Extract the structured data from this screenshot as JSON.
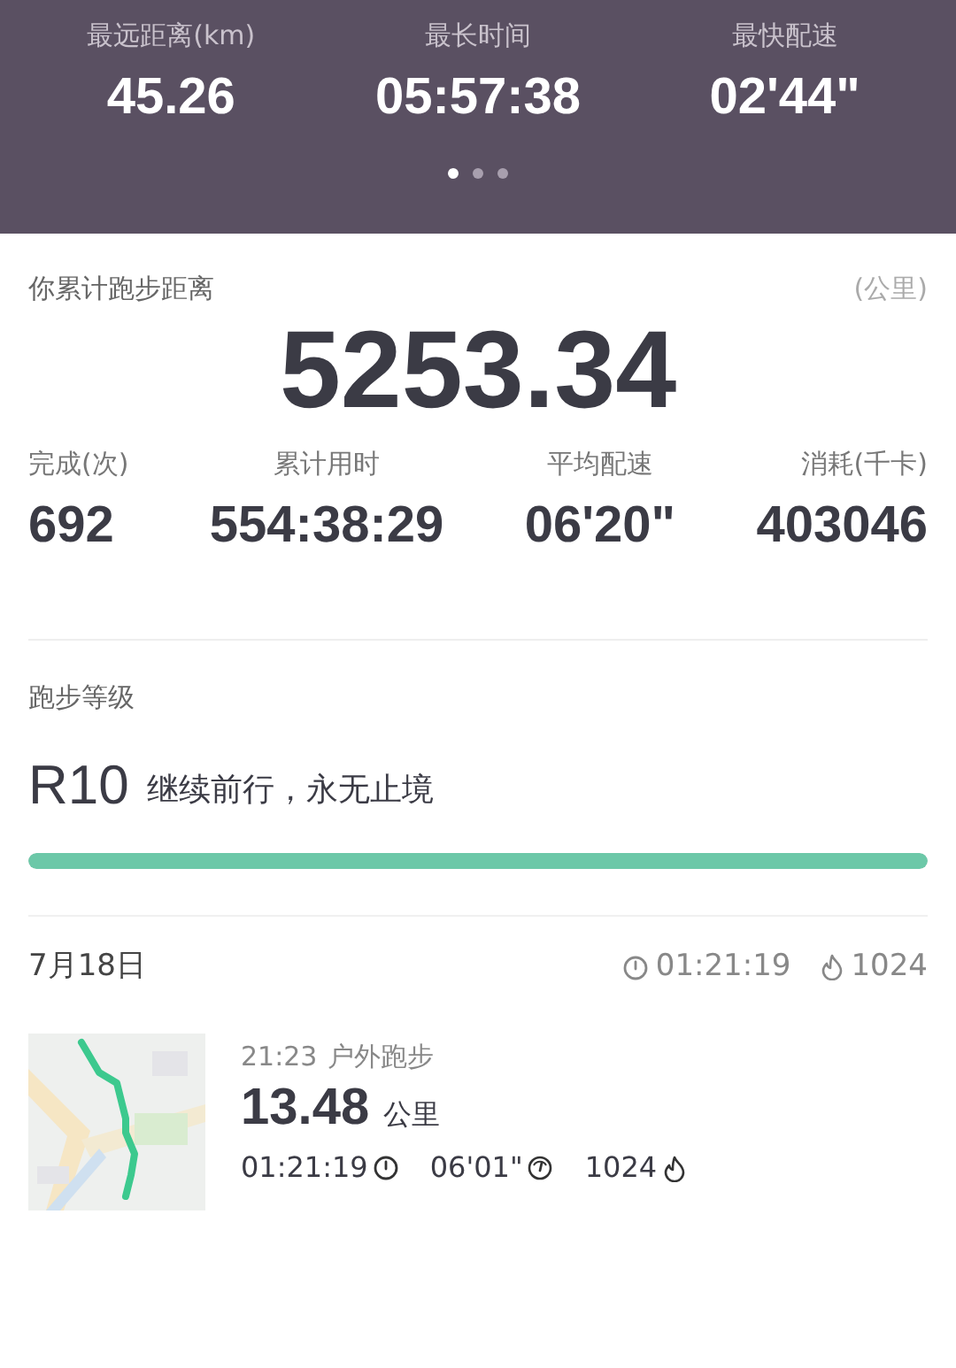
{
  "records": [
    {
      "label": "最远距离(km)",
      "value": "45.26"
    },
    {
      "label": "最长时间",
      "value": "05:57:38"
    },
    {
      "label": "最快配速",
      "value": "02'44\""
    }
  ],
  "pager": [
    {
      "selected": true
    },
    {
      "selected": false
    },
    {
      "selected": false
    }
  ],
  "total": {
    "label": "你累计跑步距离",
    "unit": "(公里)",
    "value": "5253.34"
  },
  "stats": [
    {
      "label": "完成(次)",
      "value": "692"
    },
    {
      "label": "累计用时",
      "value": "554:38:29"
    },
    {
      "label": "平均配速",
      "value": "06'20\""
    },
    {
      "label": "消耗(千卡)",
      "value": "403046"
    }
  ],
  "level": {
    "title": "跑步等级",
    "grade": "R10",
    "motto": "继续前行，永无止境",
    "level": 1.0
  },
  "day": {
    "date": "7月18日",
    "duration": "01:21:19",
    "calories": "1024"
  },
  "runs": [
    {
      "time": "21:23",
      "type": "户外跑步",
      "distance": "13.48",
      "unit": "公里",
      "duration": "01:21:19",
      "pace": "06'01\"",
      "calories": "1024"
    }
  ]
}
